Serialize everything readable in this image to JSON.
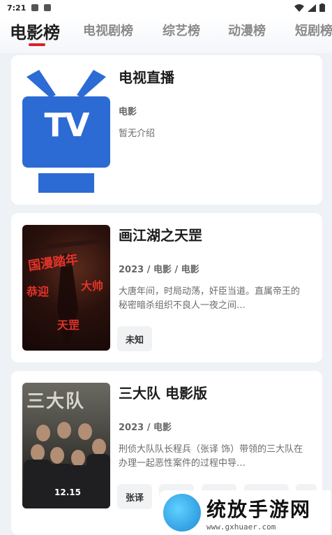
{
  "status_bar": {
    "time": "7:21"
  },
  "tabs": [
    {
      "label": "电影榜",
      "active": true
    },
    {
      "label": "电视剧榜",
      "active": false
    },
    {
      "label": "综艺榜",
      "active": false
    },
    {
      "label": "动漫榜",
      "active": false
    },
    {
      "label": "短剧榜",
      "active": false
    }
  ],
  "accent_color": "#d8232a",
  "items": [
    {
      "title": "电视直播",
      "meta": "电影",
      "desc": "暂无介绍",
      "poster_text": "TV",
      "tags": []
    },
    {
      "title": "画江湖之天罡",
      "meta": "2023 / 电影 / 电影",
      "desc": "大唐年间，时局动荡，奸臣当道。直属帝王的秘密暗杀组织不良人一夜之间…",
      "poster_text": "",
      "tags": [
        "未知"
      ]
    },
    {
      "title": "三大队 电影版",
      "meta": "2023 / 电影",
      "desc": "刑侦大队队长程兵（张译 饰）带领的三大队在办理一起恶性案件的过程中导…",
      "poster_text": "",
      "tags": [
        "张译"
      ]
    }
  ],
  "watermark": {
    "cn": "统放手游网",
    "url": "www.gxhuaer.com"
  }
}
